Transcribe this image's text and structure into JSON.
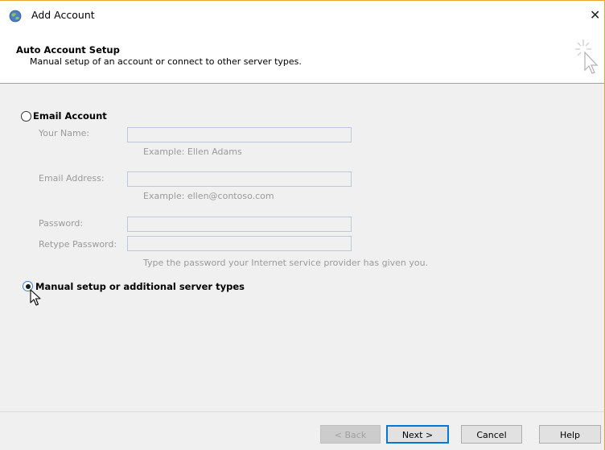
{
  "window": {
    "title": "Add Account",
    "close_glyph": "✕",
    "app_icon": "outlook-globe-icon"
  },
  "header": {
    "title": "Auto Account Setup",
    "subtitle": "Manual setup of an account or connect to other server types.",
    "icon": "wizard-sparkle-cursor-icon"
  },
  "options": {
    "email_account": {
      "label": "Email Account",
      "selected": false
    },
    "manual_setup": {
      "label": "Manual setup or additional server types",
      "selected": true
    }
  },
  "fields": {
    "your_name": {
      "label": "Your Name:",
      "value": "",
      "hint": "Example: Ellen Adams"
    },
    "email_address": {
      "label": "Email Address:",
      "value": "",
      "hint": "Example: ellen@contoso.com"
    },
    "password": {
      "label": "Password:",
      "value": ""
    },
    "retype_password": {
      "label": "Retype Password:",
      "value": "",
      "hint": "Type the password your Internet service provider has given you."
    }
  },
  "buttons": {
    "back": "< Back",
    "next": "Next >",
    "cancel": "Cancel",
    "help": "Help"
  },
  "colors": {
    "window_border": "#e8a33c",
    "default_button_border": "#0078d7",
    "disabled_text": "#9a9a9a"
  }
}
